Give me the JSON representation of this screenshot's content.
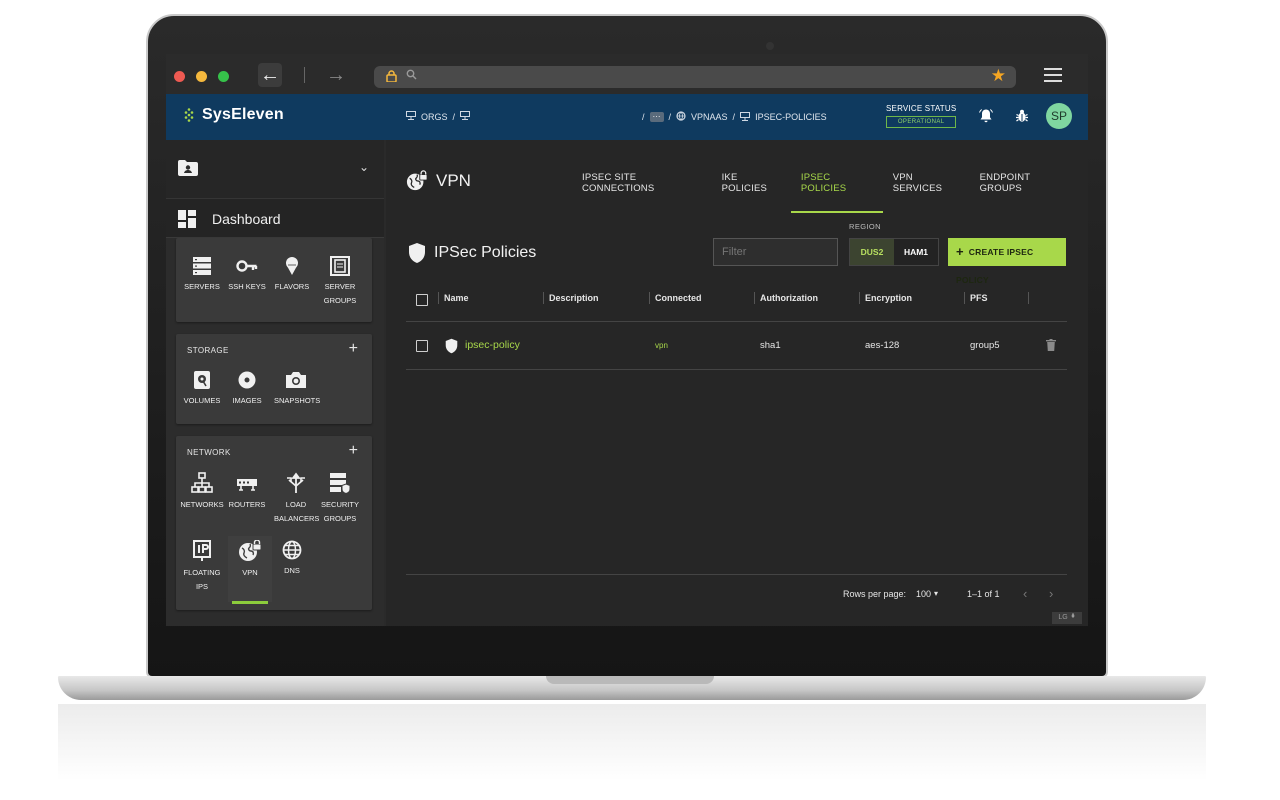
{
  "app": {
    "brand": "SysEleven",
    "accent_color": "#a8d84a",
    "header_color": "#0f3a5f"
  },
  "browser": {
    "url_text": "",
    "icons": [
      "back-arrow-icon",
      "forward-arrow-icon",
      "lock-icon",
      "search-icon",
      "star-icon",
      "menu-icon"
    ]
  },
  "header": {
    "breadcrumb_left": [
      "ORGS",
      "/"
    ],
    "breadcrumb_pill": "···",
    "breadcrumb_right": [
      "/",
      "VPNAAS",
      "/",
      "IPSEC-POLICIES"
    ],
    "service_status_label": "SERVICE STATUS",
    "service_status_value": "OPERATIONAL",
    "avatar_initials": "SP"
  },
  "sidebar": {
    "dashboard_label": "Dashboard",
    "compute": {
      "tiles": [
        {
          "label": "SERVERS",
          "icon": "servers-icon"
        },
        {
          "label": "SSH KEYS",
          "icon": "key-icon"
        },
        {
          "label": "FLAVORS",
          "icon": "flavors-icon"
        },
        {
          "label": "SERVER GROUPS",
          "icon": "server-groups-icon"
        }
      ]
    },
    "storage": {
      "title": "STORAGE",
      "tiles": [
        {
          "label": "VOLUMES",
          "icon": "volume-icon"
        },
        {
          "label": "IMAGES",
          "icon": "image-disc-icon"
        },
        {
          "label": "SNAPSHOTS",
          "icon": "camera-icon"
        }
      ]
    },
    "network": {
      "title": "NETWORK",
      "tiles": [
        {
          "label": "NETWORKS",
          "icon": "network-icon"
        },
        {
          "label": "ROUTERS",
          "icon": "router-icon"
        },
        {
          "label": "LOAD BALANCERS",
          "icon": "load-balancer-icon"
        },
        {
          "label": "SECURITY GROUPS",
          "icon": "security-group-icon"
        },
        {
          "label": "FLOATING IPS",
          "icon": "floating-ip-icon"
        },
        {
          "label": "VPN",
          "icon": "vpn-icon"
        },
        {
          "label": "DNS",
          "icon": "globe-icon"
        }
      ]
    }
  },
  "main": {
    "page_title": "VPN",
    "tabs": [
      {
        "label": "IPSEC SITE CONNECTIONS",
        "active": false
      },
      {
        "label": "IKE POLICIES",
        "active": false
      },
      {
        "label": "IPSEC POLICIES",
        "active": true
      },
      {
        "label": "VPN SERVICES",
        "active": false
      },
      {
        "label": "ENDPOINT GROUPS",
        "active": false
      }
    ],
    "section_title": "IPSec Policies",
    "filter_placeholder": "Filter",
    "region_label": "REGION",
    "regions": [
      {
        "label": "DUS2",
        "selected": true
      },
      {
        "label": "HAM1",
        "selected": false
      }
    ],
    "create_button": "CREATE IPSEC POLICY",
    "columns": [
      "Name",
      "Description",
      "Connected",
      "Authorization",
      "Encryption",
      "PFS"
    ],
    "rows": [
      {
        "name": "ipsec-policy",
        "description": "",
        "connected": "vpn",
        "authorization": "sha1",
        "encryption": "aes-128",
        "pfs": "group5"
      }
    ],
    "pagination": {
      "rows_per_page_label": "Rows per page:",
      "rows_per_page": "100",
      "range": "1–1 of 1"
    },
    "corner_badge": "LG"
  }
}
